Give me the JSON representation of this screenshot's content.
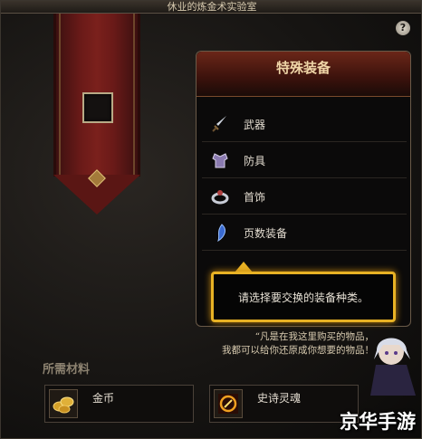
{
  "window": {
    "title": "休业的炼金术实验室"
  },
  "help": {
    "label": "?"
  },
  "panel": {
    "title": "特殊装备",
    "items": [
      {
        "label": "武器",
        "icon": "sword-icon"
      },
      {
        "label": "防具",
        "icon": "armor-icon"
      },
      {
        "label": "首饰",
        "icon": "ring-icon"
      },
      {
        "label": "页数装备",
        "icon": "tome-icon"
      }
    ]
  },
  "tooltip": {
    "text": "请选择要交换的装备种类。"
  },
  "npc": {
    "quote_line1": "“凡是在我这里购买的物品，",
    "quote_line2": "我都可以给你还原成你想要的物品！"
  },
  "materials": {
    "title": "所需材料",
    "items": [
      {
        "label": "金币",
        "icon": "gold-coin-icon"
      },
      {
        "label": "史诗灵魂",
        "icon": "epic-soul-icon"
      }
    ]
  },
  "watermark": {
    "text": "京华手游"
  },
  "colors": {
    "accent_gold": "#e8b224",
    "banner_red": "#6a1a18"
  }
}
